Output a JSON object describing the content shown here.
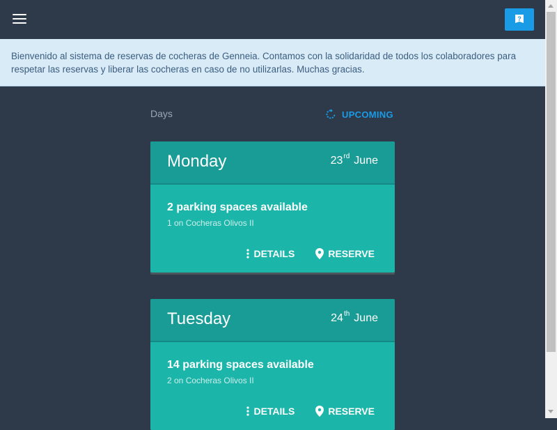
{
  "header": {
    "menu_icon": "hamburger-menu-icon",
    "help_icon": "help-book-icon",
    "help_color": "#1a9be6"
  },
  "banner": {
    "text": "Bienvenido al sistema de reservas de cocheras de Genneia. Contamos con la solidaridad de todos los colaboradores para respetar las reservas y liberar las cocheras en caso de no utilizarlas. Muchas gracias."
  },
  "list": {
    "days_label": "Days",
    "upcoming_label": "UPCOMING",
    "upcoming_icon": "refresh-icon"
  },
  "colors": {
    "background": "#2e3a4a",
    "card": "#1cb5aa",
    "card_header": "#1a9c96",
    "accent": "#1a9be6"
  },
  "cards": [
    {
      "day": "Monday",
      "date_num": "23",
      "date_suffix": "rd",
      "month": "June",
      "availability": "2 parking spaces available",
      "location": "1 on Cocheras Olivos II",
      "details_label": "DETAILS",
      "reserve_label": "RESERVE"
    },
    {
      "day": "Tuesday",
      "date_num": "24",
      "date_suffix": "th",
      "month": "June",
      "availability": "14 parking spaces available",
      "location": "2 on Cocheras Olivos II",
      "details_label": "DETAILS",
      "reserve_label": "RESERVE"
    }
  ]
}
